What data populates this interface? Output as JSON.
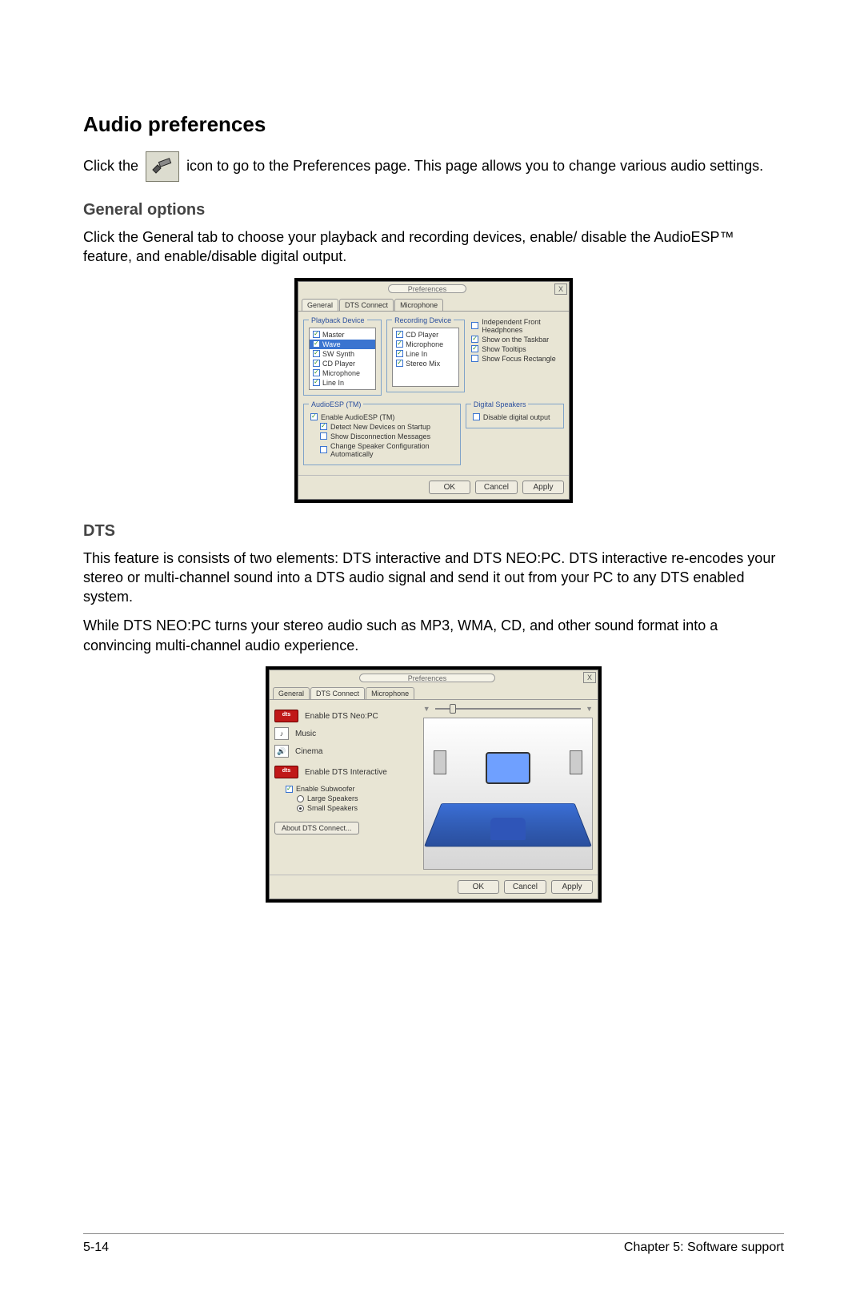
{
  "headings": {
    "h1": "Audio preferences",
    "general": "General options",
    "dts": "DTS"
  },
  "paragraphs": {
    "intro_pre": "Click the",
    "intro_post": "icon to go to the Preferences page. This page allows you to change various audio settings.",
    "general": "Click the General tab to choose your playback and recording devices, enable/ disable the AudioESP™ feature, and enable/disable digital output.",
    "dts_p1": "This feature is consists of two elements: DTS interactive and DTS NEO:PC. DTS interactive re-encodes your stereo or multi-channel sound into a DTS audio signal and send it out from your PC to any DTS enabled system.",
    "dts_p2": "While DTS NEO:PC turns your stereo audio such as MP3, WMA, CD, and other sound format into a convincing multi-channel audio experience."
  },
  "dialog1": {
    "title": "Preferences",
    "tabs": [
      "General",
      "DTS Connect",
      "Microphone"
    ],
    "activeTab": 0,
    "groups": {
      "playback": "Playback Device",
      "recording": "Recording Device",
      "esp": "AudioESP (TM)",
      "digital": "Digital Speakers"
    },
    "playbackItems": [
      {
        "label": "Master",
        "checked": true,
        "selected": false
      },
      {
        "label": "Wave",
        "checked": true,
        "selected": true
      },
      {
        "label": "SW Synth",
        "checked": true,
        "selected": false
      },
      {
        "label": "CD Player",
        "checked": true,
        "selected": false
      },
      {
        "label": "Microphone",
        "checked": true,
        "selected": false
      },
      {
        "label": "Line In",
        "checked": true,
        "selected": false
      }
    ],
    "recordingItems": [
      {
        "label": "CD Player",
        "checked": true
      },
      {
        "label": "Microphone",
        "checked": true
      },
      {
        "label": "Line In",
        "checked": true
      },
      {
        "label": "Stereo Mix",
        "checked": true
      }
    ],
    "sideOptions": [
      {
        "label": "Independent Front Headphones",
        "checked": false
      },
      {
        "label": "Show on the Taskbar",
        "checked": true
      },
      {
        "label": "Show Tooltips",
        "checked": true
      },
      {
        "label": "Show Focus Rectangle",
        "checked": false
      }
    ],
    "espOptions": {
      "enable": {
        "label": "Enable AudioESP (TM)",
        "checked": true
      },
      "subs": [
        {
          "label": "Detect New Devices on Startup",
          "checked": true
        },
        {
          "label": "Show Disconnection Messages",
          "checked": false
        },
        {
          "label": "Change Speaker Configuration Automatically",
          "checked": false
        }
      ]
    },
    "digitalOption": {
      "label": "Disable digital output",
      "checked": false
    },
    "buttons": {
      "ok": "OK",
      "cancel": "Cancel",
      "apply": "Apply"
    }
  },
  "dialog2": {
    "title": "Preferences",
    "tabs": [
      "General",
      "DTS Connect",
      "Microphone"
    ],
    "activeTab": 1,
    "neoLabel": "Enable DTS Neo:PC",
    "modes": {
      "music": "Music",
      "cinema": "Cinema"
    },
    "interactiveLabel": "Enable DTS Interactive",
    "sub": {
      "label": "Enable Subwoofer",
      "checked": true
    },
    "speakerRadios": [
      {
        "label": "Large Speakers",
        "checked": false
      },
      {
        "label": "Small Speakers",
        "checked": true
      }
    ],
    "aboutBtn": "About DTS Connect...",
    "dtsLogoText": "dts",
    "buttons": {
      "ok": "OK",
      "cancel": "Cancel",
      "apply": "Apply"
    }
  },
  "footer": {
    "page": "5-14",
    "chapter": "Chapter 5: Software support"
  }
}
